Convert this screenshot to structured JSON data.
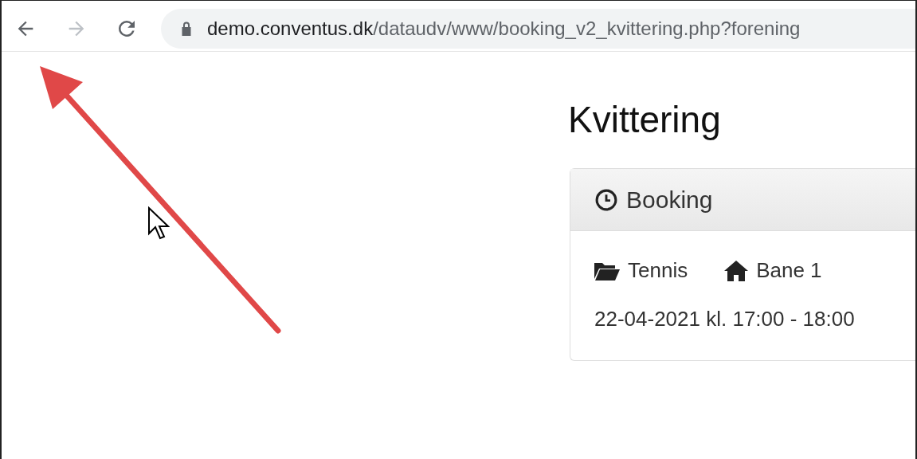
{
  "browser": {
    "url_host": "demo.conventus.dk",
    "url_path": "/dataudv/www/booking_v2_kvittering.php?forening"
  },
  "page": {
    "title": "Kvittering",
    "panel": {
      "heading": "Booking",
      "tags": [
        {
          "kind": "folder",
          "label": "Tennis"
        },
        {
          "kind": "home",
          "label": "Bane 1"
        }
      ],
      "time": "22-04-2021 kl. 17:00 - 18:00"
    }
  }
}
